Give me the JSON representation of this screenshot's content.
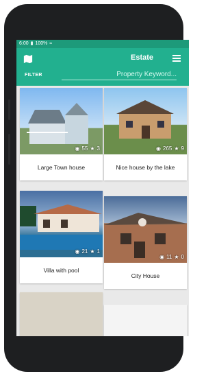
{
  "status_bar": {
    "time": "6:00",
    "battery": "100%"
  },
  "app": {
    "title": "Estate"
  },
  "search": {
    "placeholder": "Property Keyword..."
  },
  "filter_label": "FILTER",
  "listings": [
    {
      "title": "Large Town house",
      "views": "55",
      "stars": "3"
    },
    {
      "title": "Nice house by the lake",
      "views": "265",
      "stars": "9"
    },
    {
      "title": "Villa with pool",
      "views": "21",
      "stars": "1"
    },
    {
      "title": "City House",
      "views": "11",
      "stars": "0"
    }
  ],
  "colors": {
    "primary": "#22b08f",
    "status": "#1d9a7a"
  }
}
